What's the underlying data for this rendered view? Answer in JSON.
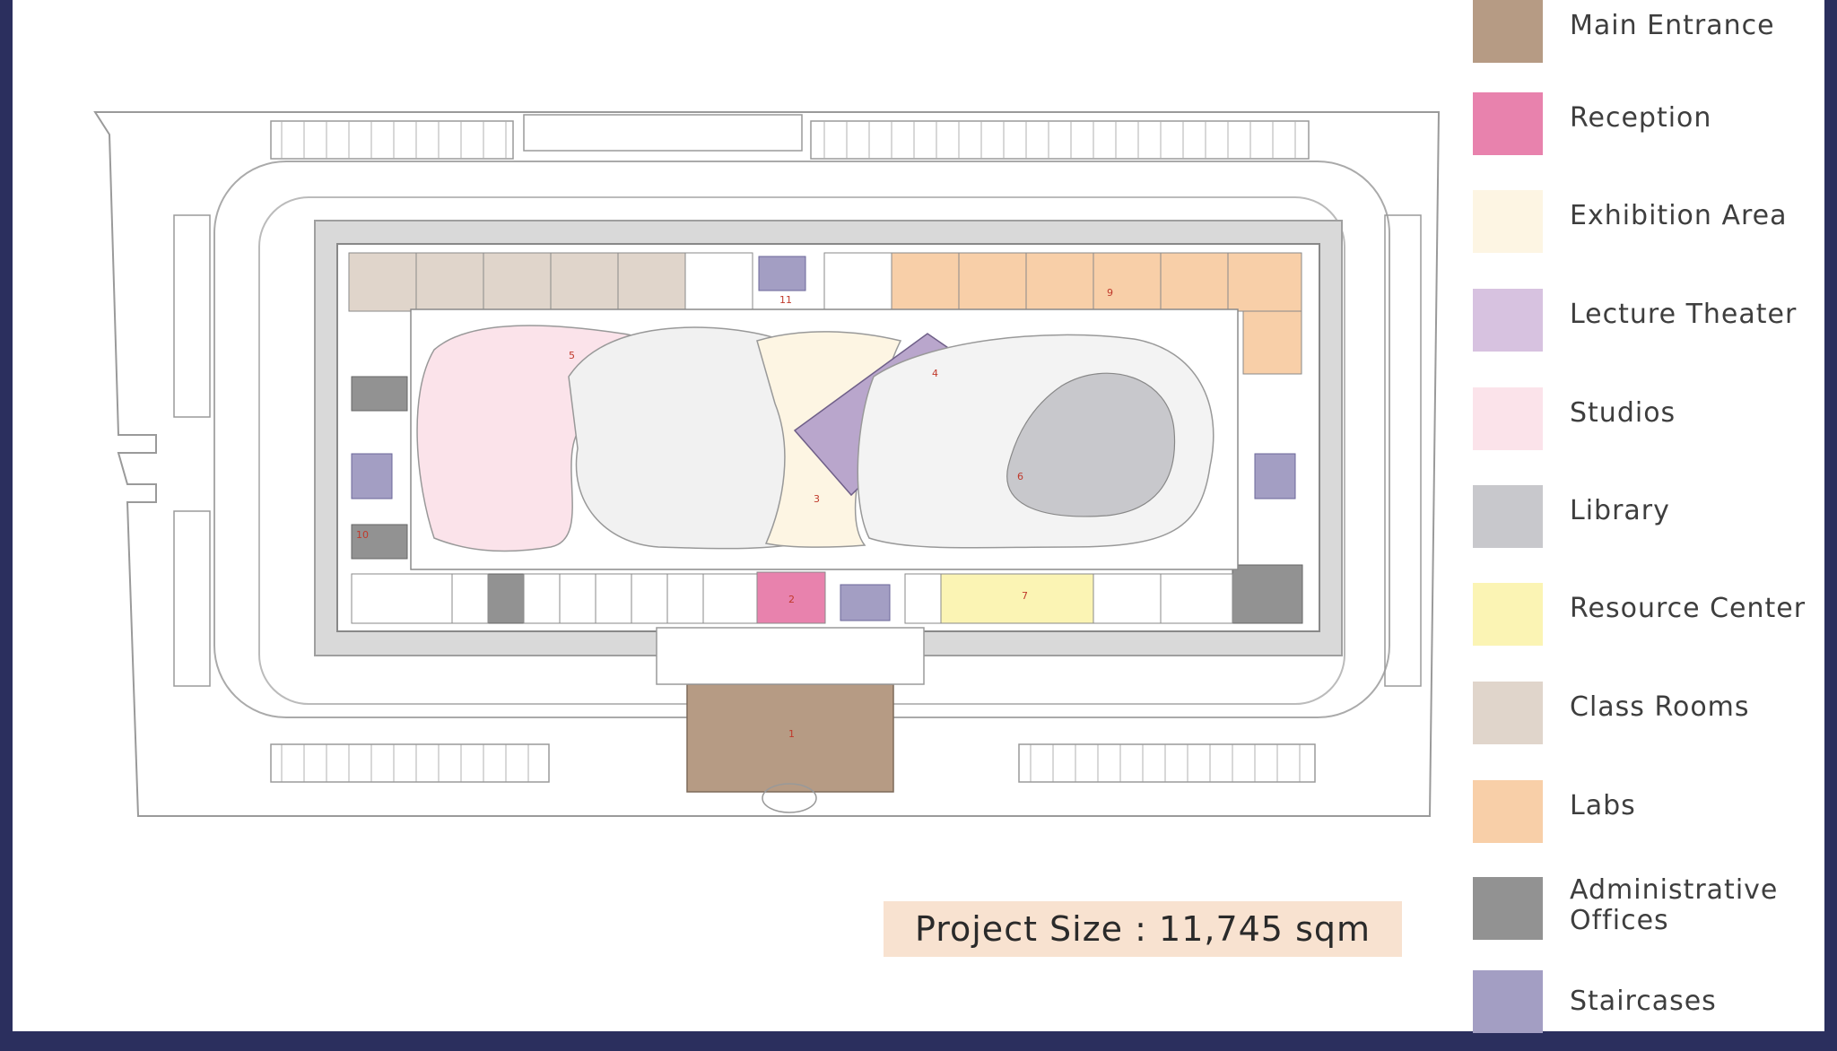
{
  "project_size": "Project Size : 11,745 sqm",
  "legend": [
    {
      "label": "Main Entrance",
      "color": "#b69b84"
    },
    {
      "label": "Reception",
      "color": "#e882ad"
    },
    {
      "label": "Exhibition Area",
      "color": "#fdf5e3"
    },
    {
      "label": "Lecture Theater",
      "color": "#d7c2e0"
    },
    {
      "label": "Studios",
      "color": "#fbe3ea"
    },
    {
      "label": "Library",
      "color": "#c8c8cc"
    },
    {
      "label": "Resource Center",
      "color": "#fbf4b4"
    },
    {
      "label": "Class Rooms",
      "color": "#e0d5cb"
    },
    {
      "label": "Labs",
      "color": "#f8cfa8"
    },
    {
      "label": "Administrative Offices",
      "color": "#929292"
    },
    {
      "label": "Staircases",
      "color": "#a39ec3"
    }
  ],
  "plan_tags": [
    "1",
    "2",
    "3",
    "4",
    "5",
    "6",
    "7",
    "9",
    "10",
    "11"
  ]
}
